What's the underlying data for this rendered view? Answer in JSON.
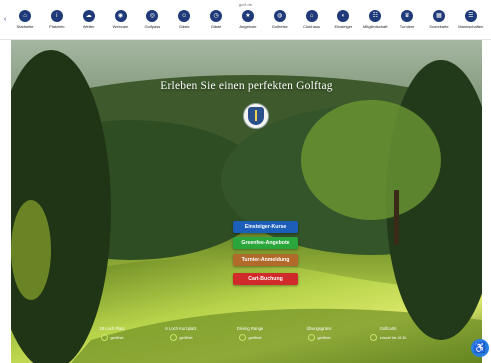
{
  "site_name": "golf.de",
  "nav": [
    {
      "label": "Startseite",
      "icon": "home-icon"
    },
    {
      "label": "Platzinfo",
      "icon": "info-icon"
    },
    {
      "label": "Wetter",
      "icon": "weather-icon"
    },
    {
      "label": "Webcam",
      "icon": "webcam-icon"
    },
    {
      "label": "Golfpass",
      "icon": "golfpass-icon"
    },
    {
      "label": "Gäste",
      "icon": "guests-icon"
    },
    {
      "label": "Gäste",
      "icon": "clock-icon"
    },
    {
      "label": "Angebote",
      "icon": "offers-icon"
    },
    {
      "label": "Golfreise",
      "icon": "globe-icon"
    },
    {
      "label": "Clubhaus",
      "icon": "clubhouse-icon"
    },
    {
      "label": "Einsteiger",
      "icon": "beginner-icon"
    },
    {
      "label": "Mitgliedschaft",
      "icon": "membership-icon"
    },
    {
      "label": "Turniere",
      "icon": "trophy-icon"
    },
    {
      "label": "Scorekarte",
      "icon": "scorecard-icon"
    },
    {
      "label": "Mannschaften",
      "icon": "team-icon"
    }
  ],
  "hero": {
    "title": "Erleben Sie einen perfekten Golftag"
  },
  "cta": {
    "beginner": "Einsteiger-Kurse",
    "greenfee": "Greenfee-Angebote",
    "tournament": "Turnier-Anmeldung",
    "cart": "Cart-Buchung"
  },
  "status": [
    {
      "title": "18 Loch Platz",
      "value": "geöffnet"
    },
    {
      "title": "6 Loch Kurzplatz",
      "value": "geöffnet"
    },
    {
      "title": "Driving Range",
      "value": "geöffnet"
    },
    {
      "title": "Übungsgrüns",
      "value": "geöffnet"
    },
    {
      "title": "Golfcarts",
      "value": "erlaubt bis 16:30"
    }
  ],
  "colors": {
    "nav_icon": "#1f3a78",
    "cta_beginner": "#1c5fb8",
    "cta_greenfee": "#2aa63a",
    "cta_tournament": "#b26a2b",
    "cta_cart": "#d12a2a",
    "accessibility": "#2a7de0"
  },
  "accessibility_icon": "accessibility-icon"
}
